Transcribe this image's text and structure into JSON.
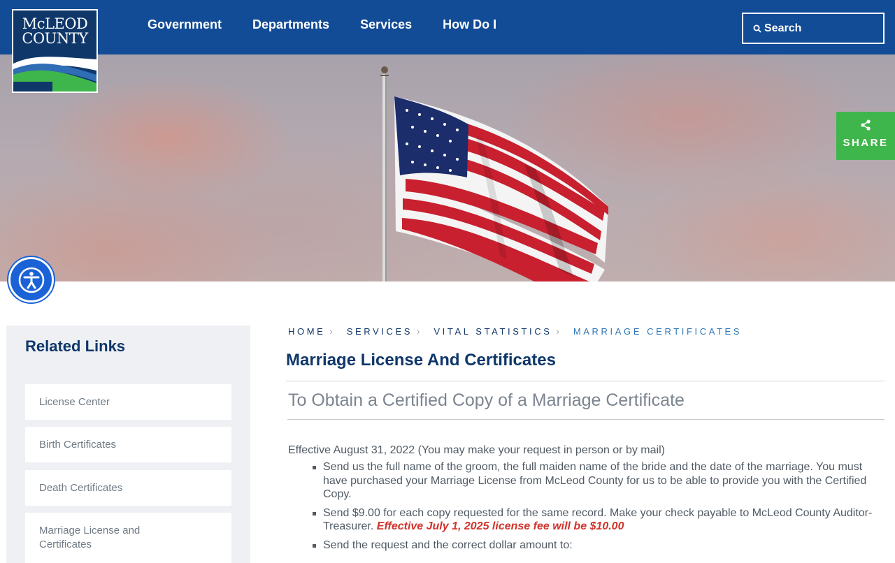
{
  "logo": {
    "line1": "McLEOD",
    "line2": "COUNTY"
  },
  "nav": {
    "items": [
      "Government",
      "Departments",
      "Services",
      "How Do I"
    ]
  },
  "search": {
    "label": "Search"
  },
  "share": {
    "label": "SHARE"
  },
  "sidebar": {
    "title": "Related Links",
    "links": [
      "License Center",
      "Birth Certificates",
      "Death Certificates",
      "Marriage License and Certificates"
    ]
  },
  "breadcrumb": [
    "HOME",
    "SERVICES",
    "VITAL STATISTICS",
    "MARRIAGE CERTIFICATES"
  ],
  "page": {
    "title": "Marriage License And Certificates",
    "subtitle": "To Obtain a Certified Copy of a Marriage Certificate",
    "effective": "Effective August 31, 2022 (You may make your request in person or by mail)",
    "bullets": [
      "Send us the full name of the groom, the full maiden name of the bride and the date of the marriage. You must have purchased your Marriage License from McLeod County for us to be able to provide you with the Certified Copy.",
      "Send $9.00 for each copy requested for the same record. Make your check payable to McLeod County Auditor-Treasurer.",
      "Send the request and the correct dollar amount to:"
    ],
    "fee_note": "Effective July 1, 2025 license fee will be $10.00"
  },
  "colors": {
    "header": "#124b96",
    "brand_navy": "#0f3769",
    "share_green": "#3fb64b",
    "accent_red": "#d0332c"
  }
}
